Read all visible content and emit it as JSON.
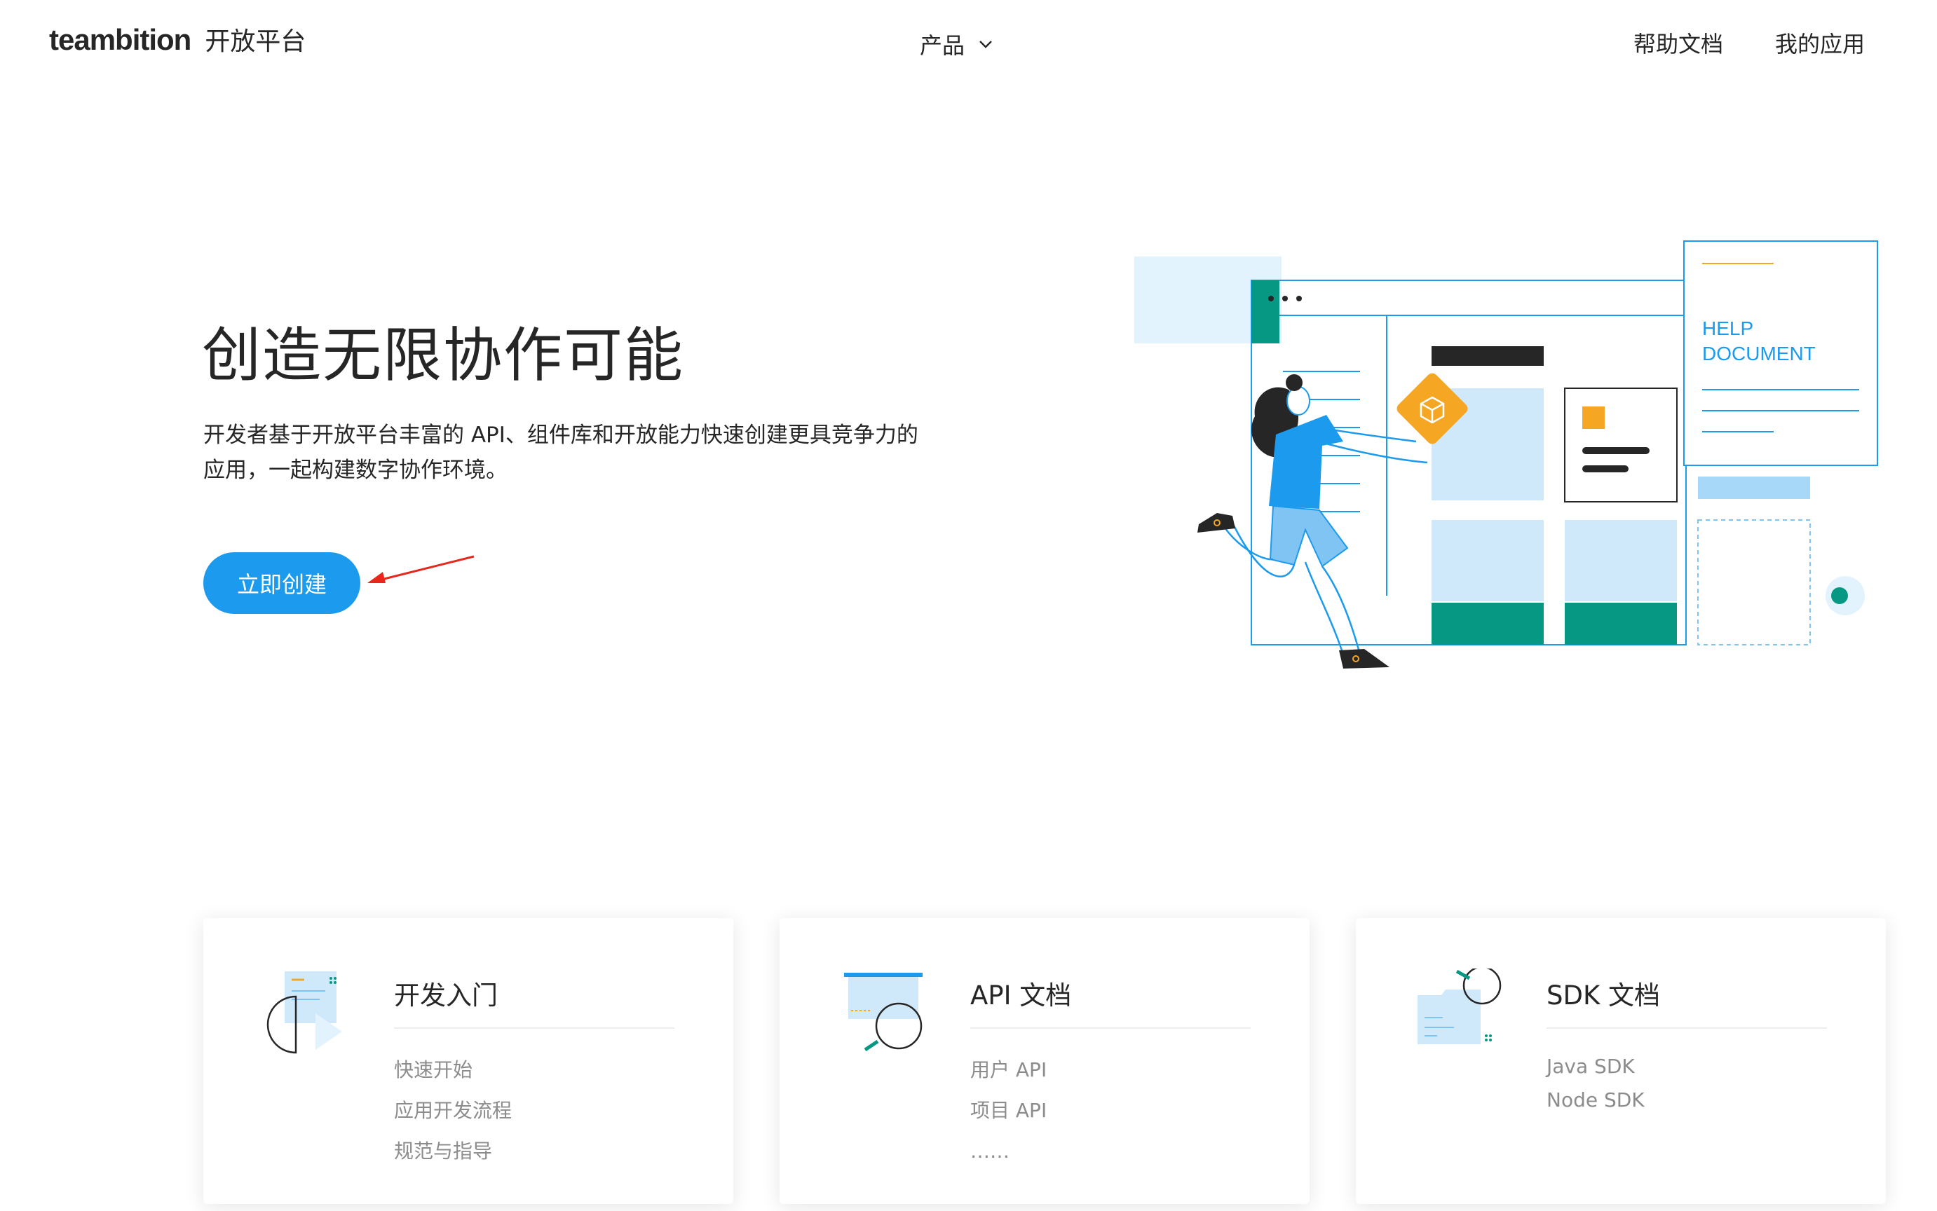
{
  "header": {
    "logo_word": "teambition",
    "logo_sub": "开放平台",
    "nav_product": "产品",
    "nav_help": "帮助文档",
    "nav_apps": "我的应用"
  },
  "hero": {
    "title": "创造无限协作可能",
    "description_line1": "开发者基于开放平台丰富的 API、组件库和开放能力快速创建更具竞争力的",
    "description_line2": "应用，一起构建数字协作环境。",
    "cta_label": "立即创建",
    "illustration_text_1": "HELP",
    "illustration_text_2": "DOCUMENT"
  },
  "cards": [
    {
      "title": "开发入门",
      "links": [
        "快速开始",
        "应用开发流程",
        "规范与指导"
      ]
    },
    {
      "title": "API 文档",
      "links": [
        "用户 API",
        "项目 API",
        "……"
      ]
    },
    {
      "title": "SDK 文档",
      "links": [
        "Java SDK",
        "Node SDK"
      ]
    }
  ],
  "colors": {
    "primary": "#1b9aee",
    "light_blue": "#cfe9fb",
    "teal": "#069882",
    "orange": "#f5a623",
    "arrow_red": "#e8261c",
    "text_dark": "#262626",
    "text_muted": "#8c8c8c"
  },
  "icons": {
    "product_dropdown": "chevron-down-icon",
    "card_1": "getting-started-icon",
    "card_2": "api-doc-icon",
    "card_3": "sdk-doc-icon"
  }
}
